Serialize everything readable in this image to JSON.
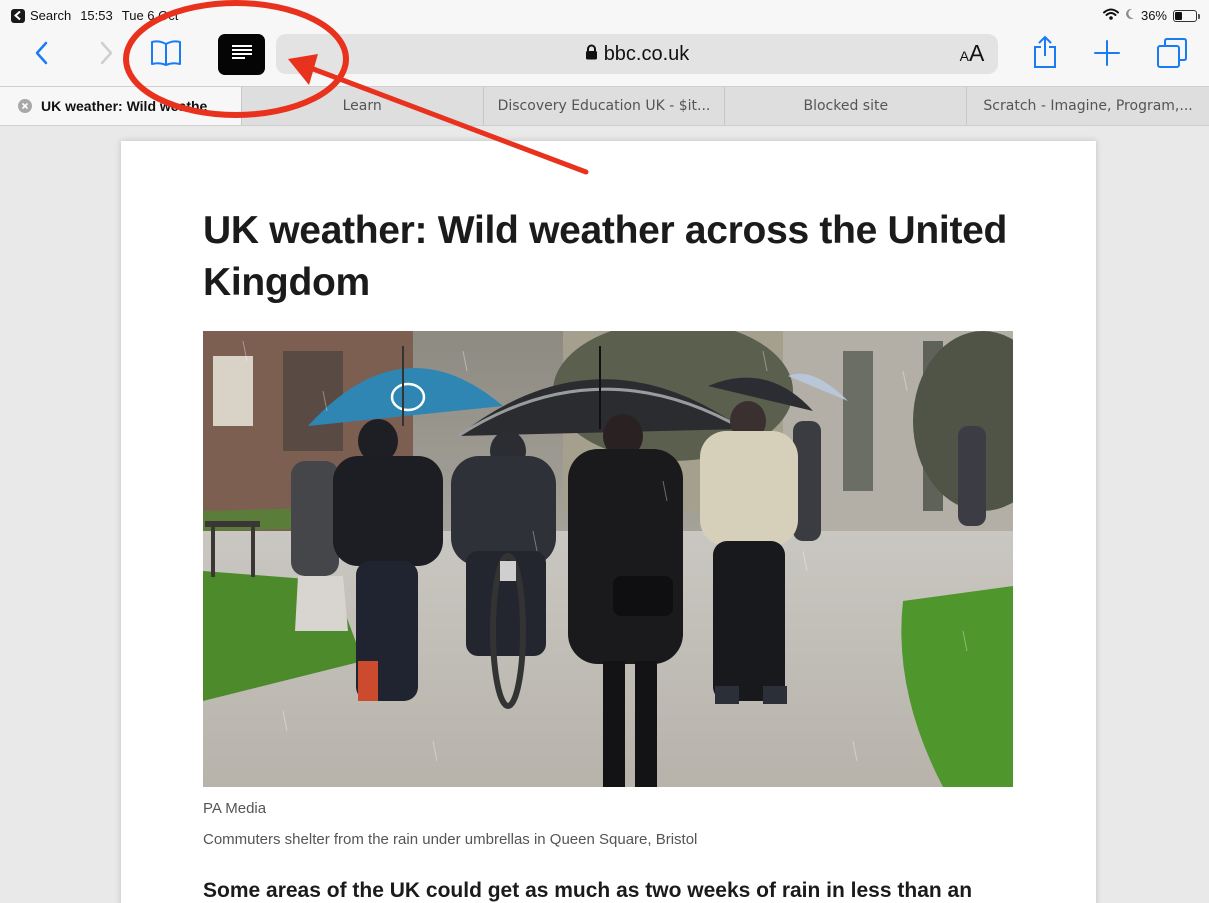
{
  "status_bar": {
    "back_app_label": "Search",
    "time": "15:53",
    "date": "Tue 6 Oct",
    "battery_percent": "36%",
    "battery_level": 0.36
  },
  "toolbar": {
    "url": "bbc.co.uk",
    "text_size_small": "A",
    "text_size_large": "A"
  },
  "tabs": [
    {
      "label": "UK weather: Wild weathe",
      "active": true
    },
    {
      "label": "Learn",
      "active": false
    },
    {
      "label": "Discovery Education UK - $it...",
      "active": false
    },
    {
      "label": "Blocked site",
      "active": false
    },
    {
      "label": "Scratch - Imagine, Program,...",
      "active": false
    }
  ],
  "article": {
    "title": "UK weather: Wild weather across the United Kingdom",
    "image_credit": "PA Media",
    "image_caption": "Commuters shelter from the rain under umbrellas in Queen Square, Bristol",
    "lede": "Some areas of the UK could get as much as two weeks of rain in less than an"
  },
  "annotation": {
    "color": "#e8321e"
  },
  "icons": {
    "back": "chevron-left-icon",
    "forward": "chevron-right-icon",
    "bookmarks": "book-icon",
    "reader": "reader-view-icon",
    "lock": "lock-icon",
    "share": "share-icon",
    "new_tab": "plus-icon",
    "tabs": "tabs-overview-icon",
    "wifi": "wifi-icon",
    "moon": "moon-icon",
    "battery": "battery-icon"
  },
  "colors": {
    "accent": "#1a7cf5",
    "reader_bg": "#050505"
  }
}
